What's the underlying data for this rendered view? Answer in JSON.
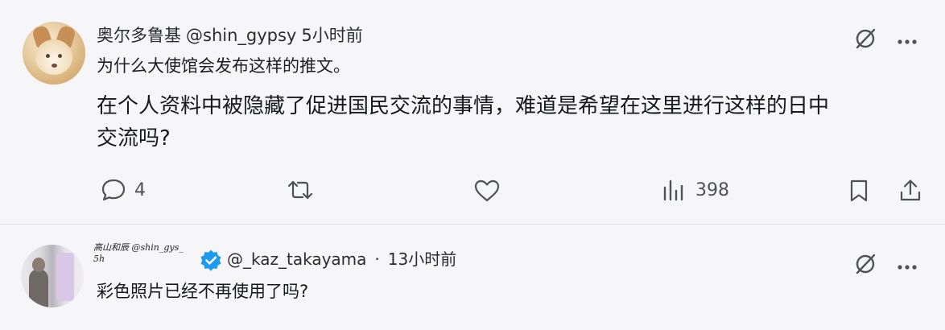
{
  "tweet1": {
    "display_name": "奥尔多鲁基",
    "handle": "@shin_gypsy",
    "time": "5小时前",
    "line1": "为什么大使馆会发布这样的推文。",
    "body_line1": "在个人资料中被隐藏了促进国民交流的事情，难道是希望在这里进行这样的日中",
    "body_line2": "交流吗?",
    "reply_count": "4",
    "view_count": "398"
  },
  "tweet2": {
    "reply_context_line1": "高山和辰 @shin_gys_",
    "reply_context_line2": "5h",
    "handle": "@_kaz_takayama",
    "separator": "·",
    "time": "13小时前",
    "body": "彩色照片已经不再使用了吗?"
  },
  "icons": {
    "reply": "speech-bubble-icon",
    "retweet": "retweet-icon",
    "like": "heart-icon",
    "views": "bar-chart-icon",
    "bookmark": "bookmark-icon",
    "share": "share-upload-icon",
    "muted": "circle-slash-icon",
    "more": "more-dots-icon",
    "verified": "verified-badge-icon"
  },
  "colors": {
    "background": "#f6f6f8",
    "text": "#16181c",
    "icon": "#4e5158",
    "verified": "#1d9bf0"
  }
}
